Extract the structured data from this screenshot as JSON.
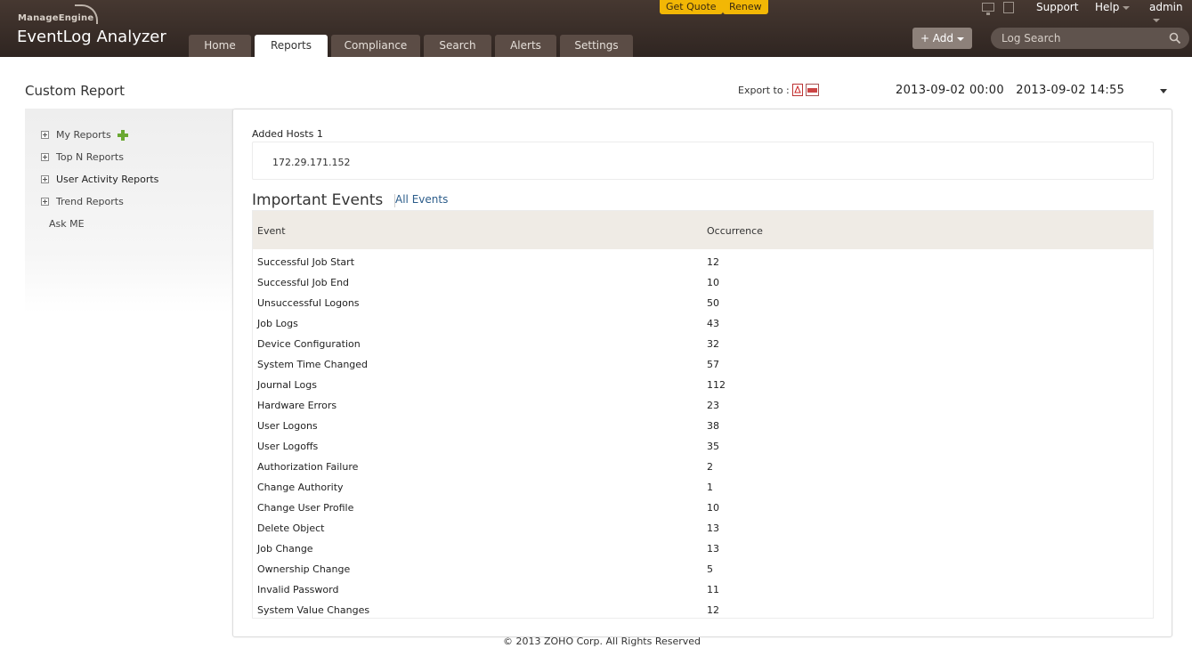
{
  "brand": {
    "company": "ManageEngine",
    "product": "EventLog Analyzer"
  },
  "promos": {
    "quote": "Get Quote",
    "renew": "Renew"
  },
  "top_links": {
    "support": "Support",
    "help": "Help",
    "user": "admin"
  },
  "tabs": [
    {
      "label": "Home",
      "active": false
    },
    {
      "label": "Reports",
      "active": true
    },
    {
      "label": "Compliance",
      "active": false
    },
    {
      "label": "Search",
      "active": false
    },
    {
      "label": "Alerts",
      "active": false
    },
    {
      "label": "Settings",
      "active": false
    }
  ],
  "add_button": {
    "label": "+ Add"
  },
  "search": {
    "placeholder": "Log Search"
  },
  "page": {
    "title": "Custom Report",
    "export_label": "Export to :",
    "date_from": "2013-09-02 00:00",
    "date_to": "2013-09-02 14:55"
  },
  "sidebar": {
    "items": [
      {
        "label": "My Reports",
        "expandable": true
      },
      {
        "label": "Top N Reports",
        "expandable": true
      },
      {
        "label": "User Activity Reports",
        "expandable": true
      },
      {
        "label": "Trend Reports",
        "expandable": true
      },
      {
        "label": "Ask ME",
        "expandable": false
      }
    ]
  },
  "hosts": {
    "label": "Added Hosts 1",
    "ip": "172.29.171.152"
  },
  "events": {
    "title": "Important Events",
    "all_link": "All Events",
    "columns": [
      "Event",
      "Occurrence"
    ],
    "rows": [
      [
        "Successful Job Start",
        "12"
      ],
      [
        "Successful Job End",
        "10"
      ],
      [
        "Unsuccessful Logons",
        "50"
      ],
      [
        "Job Logs",
        "43"
      ],
      [
        "Device Configuration",
        "32"
      ],
      [
        "System Time Changed",
        "57"
      ],
      [
        "Journal Logs",
        "112"
      ],
      [
        "Hardware Errors",
        "23"
      ],
      [
        "User Logons",
        "38"
      ],
      [
        "User Logoffs",
        "35"
      ],
      [
        "Authorization Failure",
        "2"
      ],
      [
        "Change Authority",
        "1"
      ],
      [
        "Change User Profile",
        "10"
      ],
      [
        "Delete Object",
        "13"
      ],
      [
        "Job Change",
        "13"
      ],
      [
        "Ownership Change",
        "5"
      ],
      [
        "Invalid Password",
        "11"
      ],
      [
        "System Value Changes",
        "12"
      ]
    ]
  },
  "footer": {
    "text": "© 2013 ZOHO Corp. All Rights Reserved"
  },
  "colors": {
    "header_bg": "#3b2f2a",
    "promo": "#f2b705",
    "link": "#2b5c8a",
    "add_icon": "#6aa832"
  }
}
